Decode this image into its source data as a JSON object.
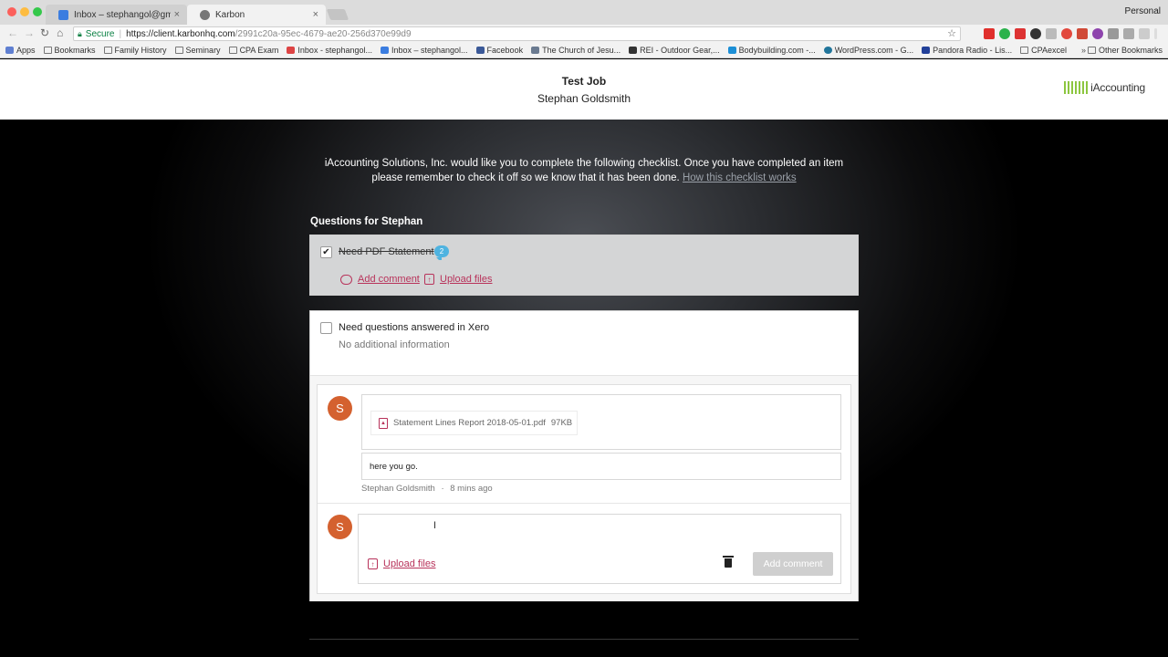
{
  "browser": {
    "tabs": [
      {
        "label": "Inbox – stephangol@gmail.com",
        "active": false,
        "icon": "gmail-icon"
      },
      {
        "label": "Karbon",
        "active": true,
        "icon": "karbon-icon"
      }
    ],
    "profile": "Personal",
    "url": {
      "secure_label": "Secure",
      "scheme_host": "https://client.karbonhq.com",
      "path": "/2991c20a-95ec-4679-ae20-256d370e99d9"
    },
    "bookmarks": [
      {
        "label": "Apps",
        "icon": "apps-grid-icon"
      },
      {
        "label": "Bookmarks",
        "icon": "folder-icon"
      },
      {
        "label": "Family History",
        "icon": "folder-icon"
      },
      {
        "label": "Seminary",
        "icon": "folder-icon"
      },
      {
        "label": "CPA Exam",
        "icon": "folder-icon"
      },
      {
        "label": "Inbox - stephangol...",
        "icon": "gmail-icon"
      },
      {
        "label": "Inbox – stephangol...",
        "icon": "inbox-icon"
      },
      {
        "label": "Facebook",
        "icon": "facebook-icon"
      },
      {
        "label": "The Church of Jesu...",
        "icon": "church-icon"
      },
      {
        "label": "REI - Outdoor Gear,...",
        "icon": "rei-icon"
      },
      {
        "label": "Bodybuilding.com -...",
        "icon": "bodybuilding-icon"
      },
      {
        "label": "WordPress.com - G...",
        "icon": "wordpress-icon"
      },
      {
        "label": "Pandora Radio - Lis...",
        "icon": "pandora-icon"
      },
      {
        "label": "CPAexcel",
        "icon": "page-icon"
      }
    ],
    "other_bookmarks": "Other Bookmarks",
    "more": "»"
  },
  "header": {
    "title": "Test Job",
    "client": "Stephan Goldsmith",
    "brand": "iAccounting"
  },
  "intro": {
    "text": "iAccounting Solutions, Inc. would like you to complete the following checklist. Once you have completed an item please remember to check it off so we know that it has been done.",
    "link": "How this checklist works"
  },
  "section_title": "Questions for Stephan",
  "items": [
    {
      "title": "Need PDF Statement",
      "checked": true,
      "comment_count": "2",
      "add_comment": "Add comment",
      "upload_files": "Upload files"
    },
    {
      "title": "Need questions answered in Xero",
      "checked": false,
      "info": "No additional information",
      "comments": [
        {
          "avatar": "S",
          "file_name": "Statement Lines Report 2018-05-01.pdf",
          "file_size": "97KB",
          "message": "here you go.",
          "author": "Stephan Goldsmith",
          "meta_sep": "·",
          "time": "8 mins ago"
        }
      ],
      "compose": {
        "avatar": "S",
        "cursor": "I",
        "upload_files": "Upload files",
        "add_comment": "Add comment"
      }
    }
  ],
  "colors": {
    "accent": "#b8325a",
    "avatar": "#d4612f",
    "badge": "#4fb3e0",
    "brand_green": "#8cc63f"
  }
}
